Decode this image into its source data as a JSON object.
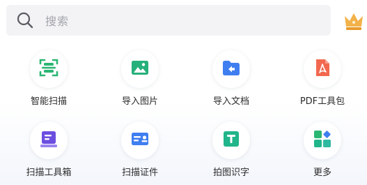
{
  "search": {
    "placeholder": "搜索",
    "icon": "search-icon"
  },
  "header": {
    "vip_icon": "crown-icon",
    "vip_color": "#f0a93c"
  },
  "tools": [
    {
      "label": "智能扫描",
      "icon": "scan-frame-icon",
      "color": "#2bb673"
    },
    {
      "label": "导入图片",
      "icon": "image-icon",
      "color": "#26b07a"
    },
    {
      "label": "导入文档",
      "icon": "folder-import-icon",
      "color": "#3f7ef0"
    },
    {
      "label": "PDF工具包",
      "icon": "pdf-icon",
      "color": "#f2684f"
    },
    {
      "label": "扫描工具箱",
      "icon": "toolbox-icon",
      "color": "#6d4fe0"
    },
    {
      "label": "扫描证件",
      "icon": "id-card-icon",
      "color": "#3f7ef0"
    },
    {
      "label": "拍图识字",
      "icon": "text-recognition-icon",
      "color": "#20b58a"
    },
    {
      "label": "更多",
      "icon": "more-apps-icon",
      "color": "#2fb9a0"
    }
  ]
}
